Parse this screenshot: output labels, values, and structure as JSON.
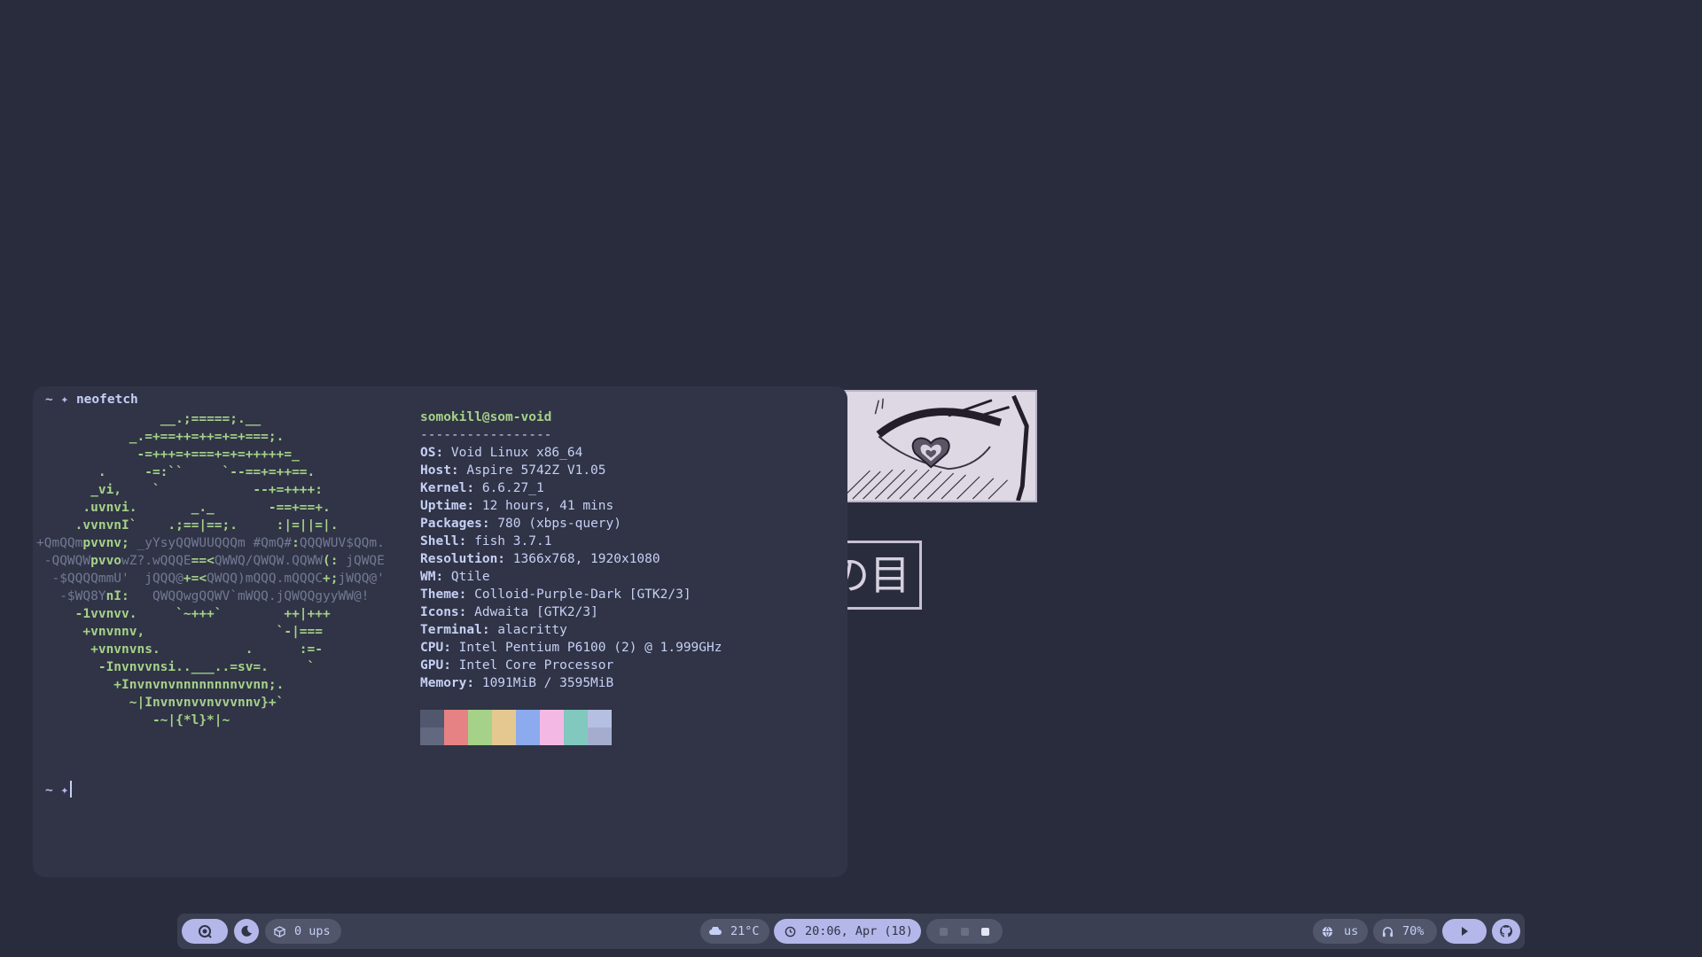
{
  "terminal": {
    "prompt_symbol": "~ ✦",
    "command": "neofetch",
    "ascii_art": [
      [
        [
          "                ",
          "g"
        ],
        [
          "__.;=====;.__",
          "g"
        ]
      ],
      [
        [
          "            _.=+==++=++=+=+===;.",
          "g"
        ]
      ],
      [
        [
          "             -=+++=+===+=+=+++++=_",
          "g"
        ]
      ],
      [
        [
          "        .     -=:``     `--==+=++==.",
          "g"
        ]
      ],
      [
        [
          "       _vi,    `            --+=++++:",
          "g"
        ]
      ],
      [
        [
          "      .uvnvi.       _._       -==+==+.",
          "g"
        ]
      ],
      [
        [
          "     .vvnvnI`    .;==|==;.     :|=||=|.",
          "g"
        ]
      ],
      [
        [
          "+QmQQm",
          "d"
        ],
        [
          "pvvnv; ",
          "g"
        ],
        [
          "_yYsyQQWUUQQQm #QmQ#",
          "d"
        ],
        [
          ":",
          "g"
        ],
        [
          "QQQWUV$QQm.",
          "d"
        ]
      ],
      [
        [
          " -QQWQW",
          "d"
        ],
        [
          "pvvo",
          "g"
        ],
        [
          "wZ?.wQQQE",
          "d"
        ],
        [
          "==<",
          "g"
        ],
        [
          "QWWQ/QWQW.QQWW",
          "d"
        ],
        [
          "(: ",
          "g"
        ],
        [
          "jQWQE",
          "d"
        ]
      ],
      [
        [
          "  -$QQQQmmU'  jQQQ@",
          "d"
        ],
        [
          "+=<",
          "g"
        ],
        [
          "QWQQ)mQQQ.mQQQC",
          "d"
        ],
        [
          "+;",
          "g"
        ],
        [
          "jWQQ@'",
          "d"
        ]
      ],
      [
        [
          "   -$WQ8Y",
          "d"
        ],
        [
          "nI:   ",
          "g"
        ],
        [
          "QWQQwgQQWV`mWQQ.jQWQQgyyWW@!",
          "d"
        ]
      ],
      [
        [
          "     -1vvnvv.     `~+++`        ++|+++",
          "g"
        ]
      ],
      [
        [
          "      +vnvnnv,                 `-|===",
          "g"
        ]
      ],
      [
        [
          "       +vnvnvns.           .      :=-",
          "g"
        ]
      ],
      [
        [
          "        -Invnvvnsi..___..=sv=.     `",
          "g"
        ]
      ],
      [
        [
          "          +Invnvnvnnnnnnnnvvnn;.",
          "g"
        ]
      ],
      [
        [
          "            ~|Invnvnvvnvvvnnv}+`",
          "g"
        ]
      ],
      [
        [
          "               -~|{*l}*|~",
          "g"
        ]
      ]
    ],
    "user_host": "somokill@som-void",
    "separator": "-----------------",
    "info": [
      {
        "key": "OS:",
        "value": " Void Linux x86_64"
      },
      {
        "key": "Host:",
        "value": " Aspire 5742Z V1.05"
      },
      {
        "key": "Kernel:",
        "value": " 6.6.27_1"
      },
      {
        "key": "Uptime:",
        "value": " 12 hours, 41 mins"
      },
      {
        "key": "Packages:",
        "value": " 780 (xbps-query)"
      },
      {
        "key": "Shell:",
        "value": " fish 3.7.1"
      },
      {
        "key": "Resolution:",
        "value": " 1366x768, 1920x1080"
      },
      {
        "key": "WM:",
        "value": " Qtile"
      },
      {
        "key": "Theme:",
        "value": " Colloid-Purple-Dark [GTK2/3]"
      },
      {
        "key": "Icons:",
        "value": " Adwaita [GTK2/3]"
      },
      {
        "key": "Terminal:",
        "value": " alacritty"
      },
      {
        "key": "CPU:",
        "value": " Intel Pentium P6100 (2) @ 1.999GHz"
      },
      {
        "key": "GPU:",
        "value": " Intel Core Processor"
      },
      {
        "key": "Memory:",
        "value": " 1091MiB / 3595MiB"
      }
    ],
    "palette_top": [
      "#51576d",
      "#e78284",
      "#a6d189",
      "#e5c890",
      "#8caaee",
      "#f4b8e4",
      "#81c8be",
      "#b5bfe2"
    ],
    "palette_bottom": [
      "#626880",
      "#e78284",
      "#a6d189",
      "#e5c890",
      "#8caaee",
      "#f4b8e4",
      "#81c8be",
      "#a5adce"
    ]
  },
  "wallpaper": {
    "kanji": "の目"
  },
  "bar": {
    "updates": "0 ups",
    "weather": "21°C",
    "clock": "20:06, Apr (18)",
    "keyboard_layout": "us",
    "volume": "70%"
  }
}
